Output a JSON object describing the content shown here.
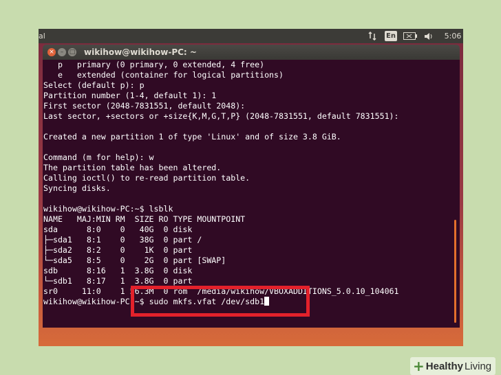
{
  "topbar": {
    "app_name": "al",
    "keyboard_layout": "En",
    "clock": "5:06",
    "icons": [
      "sync-icon",
      "battery-icon",
      "volume-icon"
    ]
  },
  "window": {
    "title": "wikihow@wikihow-PC: ~",
    "close_glyph": "×",
    "minimize_glyph": "–",
    "maximize_glyph": "□"
  },
  "terminal": {
    "lines": [
      "   p   primary (0 primary, 0 extended, 4 free)",
      "   e   extended (container for logical partitions)",
      "Select (default p): p",
      "Partition number (1-4, default 1): 1",
      "First sector (2048-7831551, default 2048):",
      "Last sector, +sectors or +size{K,M,G,T,P} (2048-7831551, default 7831551):",
      "",
      "Created a new partition 1 of type 'Linux' and of size 3.8 GiB.",
      "",
      "Command (m for help): w",
      "The partition table has been altered.",
      "Calling ioctl() to re-read partition table.",
      "Syncing disks.",
      "",
      "wikihow@wikihow-PC:~$ lsblk",
      "NAME   MAJ:MIN RM  SIZE RO TYPE MOUNTPOINT",
      "sda      8:0    0   40G  0 disk",
      "├─sda1   8:1    0   38G  0 part /",
      "├─sda2   8:2    0    1K  0 part",
      "└─sda5   8:5    0    2G  0 part [SWAP]",
      "sdb      8:16   1  3.8G  0 disk",
      "└─sdb1   8:17   1  3.8G  0 part",
      "sr0     11:0    1 56.3M  0 rom  /media/wikihow/VBOXADDITIONS_5.0.10_104061"
    ],
    "prompt": "wikihow@wikihow-PC:~$ ",
    "current_command": "sudo mkfs.vfat /dev/sdb1"
  },
  "watermark": {
    "word1": "Healthy",
    "word2": "Living",
    "mark": "+"
  },
  "colors": {
    "terminal_bg": "#300a24",
    "highlight": "#e3212b",
    "accent": "#e36f2c"
  }
}
